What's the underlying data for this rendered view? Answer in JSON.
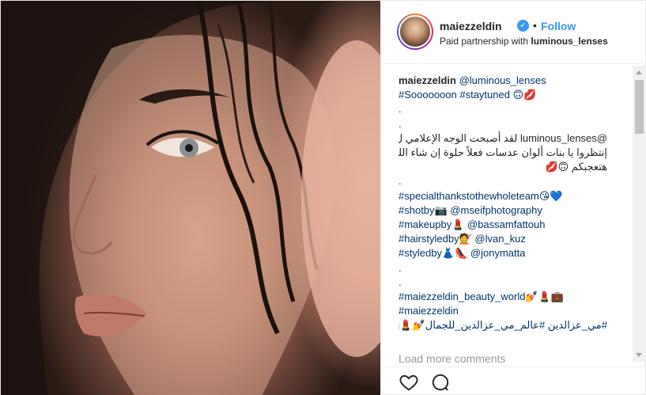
{
  "header": {
    "username": "maiezzeldin",
    "verified_icon": "check-icon",
    "separator": "•",
    "follow_label": "Follow",
    "partnership_prefix": "Paid partnership with ",
    "partner": "luminous_lenses"
  },
  "comments": {
    "line1_user": "maiezzeldin",
    "line1_text": " @luminous_lenses",
    "line2": "#Sooooooon #staytuned 🙃💋",
    "line3": ".",
    "line4": ".",
    "line5": "@luminous_lenses لقد أصبحت الوجه الإعلامي ل",
    "line6": "إنتظروا يا بنات ألوان عدسات فعلاً حلوة إن شاء الله",
    "line7": "هتعجبكم 🙃💋",
    "line8": ".",
    "line9": "#specialthankstothewholeteam😘💙",
    "line10": "#shotby📷 @mseifphotography",
    "line11": "#makeupby💄 @bassamfattouh",
    "line12": "#hairstyledby💇 @lvan_kuz",
    "line13": "#styledby👗👠 @jonymatta",
    "line14": ".",
    "line15": ".",
    "line16": "#maiezzeldin_beauty_world💅💄💼",
    "line17": "#maiezzeldin",
    "line18": "#مي_عزالدين #عالم_مي_عزالدين_للجمال💅💄💼"
  },
  "load_more": "Load more comments",
  "actions": {
    "like_icon": "heart-icon",
    "comment_icon": "comment-icon"
  }
}
